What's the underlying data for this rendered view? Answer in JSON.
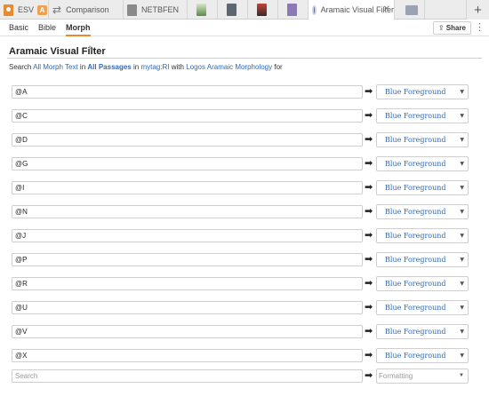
{
  "tabs": [
    {
      "label": "ESV",
      "badge": "A",
      "icon": "book-icon"
    },
    {
      "label": "Comparison",
      "icon": "swap-icon"
    },
    {
      "label": "NETBFEN",
      "icon": "book-icon"
    },
    {
      "label": "",
      "icon": "thumbnail-icon"
    },
    {
      "label": "",
      "icon": "thumbnail-icon"
    },
    {
      "label": "",
      "icon": "thumbnail-icon"
    },
    {
      "label": "",
      "icon": "thumbnail-icon"
    },
    {
      "label": "Aramaic Visual Filter",
      "icon": "filter-icon",
      "active": true
    },
    {
      "label": "",
      "icon": "stack-icon"
    }
  ],
  "new_tab": "+",
  "subtabs": [
    "Basic",
    "Bible",
    "Morph"
  ],
  "active_subtab": "Morph",
  "share_label": "Share",
  "title": "Aramaic Visual Filter",
  "search_line": {
    "prefix": "Search",
    "scope": "All Morph Text",
    "in": "in",
    "passages": "All Passages",
    "in2": "in",
    "tag": "mytag:RI",
    "with": "with",
    "morphology": "Logos Aramaic Morphology",
    "for": "for"
  },
  "rules": [
    {
      "query": "@A",
      "format": "Blue Foreground"
    },
    {
      "query": "@C",
      "format": "Blue Foreground"
    },
    {
      "query": "@D",
      "format": "Blue Foreground"
    },
    {
      "query": "@G",
      "format": "Blue Foreground"
    },
    {
      "query": "@I",
      "format": "Blue Foreground"
    },
    {
      "query": "@N",
      "format": "Blue Foreground"
    },
    {
      "query": "@J",
      "format": "Blue Foreground"
    },
    {
      "query": "@P",
      "format": "Blue Foreground"
    },
    {
      "query": "@R",
      "format": "Blue Foreground"
    },
    {
      "query": "@U",
      "format": "Blue Foreground"
    },
    {
      "query": "@V",
      "format": "Blue Foreground"
    },
    {
      "query": "@X",
      "format": "Blue Foreground"
    }
  ],
  "new_rule": {
    "query_placeholder": "Search",
    "format_placeholder": "Formatting"
  },
  "colors": {
    "accent": "#e88a2e",
    "link": "#2f6ab5"
  }
}
